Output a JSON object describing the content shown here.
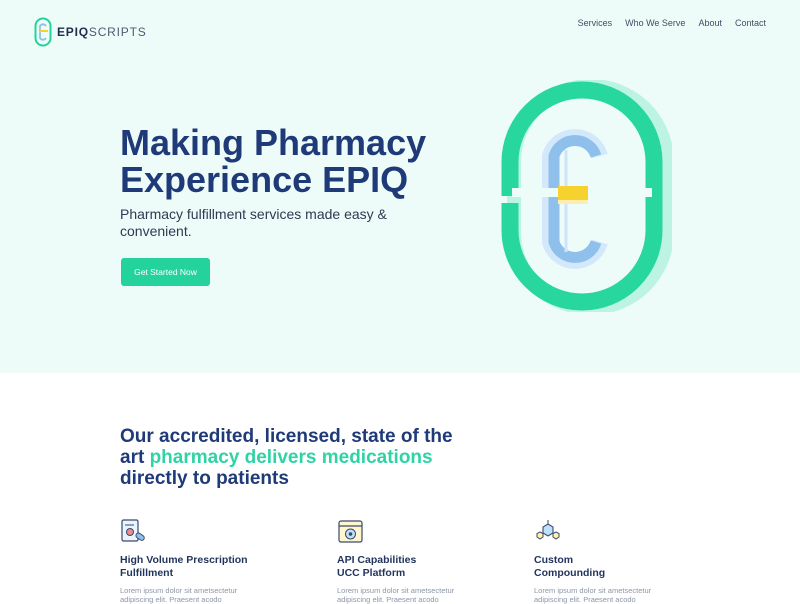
{
  "brand": {
    "name_bold": "EPIQ",
    "name_light": "SCRIPTS"
  },
  "nav": {
    "items": [
      "Services",
      "Who We Serve",
      "About",
      "Contact"
    ]
  },
  "hero": {
    "headline_line1": "Making Pharmacy",
    "headline_line2": "Experience EPIQ",
    "subtext_line1": "Pharmacy fulfillment services made easy &",
    "subtext_line2": "convenient.",
    "cta_label": "Get Started Now"
  },
  "section": {
    "intro_line1": "Our accredited, licensed, state of the",
    "intro_line2_a": "art ",
    "intro_line2_accent": "pharmacy delivers medications",
    "intro_line3": "directly to patients",
    "features": [
      {
        "icon": "prescription-document-icon",
        "title_line1": "High Volume Prescription",
        "title_line2": "Fulfillment",
        "body_line1": "Lorem ipsum dolor sit ametsectetur",
        "body_line2": "adipiscing elit. Praesent acodo"
      },
      {
        "icon": "api-window-icon",
        "title_line1": "API Capabilities",
        "title_line2": "UCC Platform",
        "body_line1": "Lorem ipsum dolor sit ametsectetur",
        "body_line2": "adipiscing elit. Praesent acodo"
      },
      {
        "icon": "molecule-icon",
        "title_line1": "Custom",
        "title_line2": "Compounding",
        "body_line1": "Lorem ipsum dolor sit ametsectetur",
        "body_line2": "adipiscing elit. Praesent acodo"
      }
    ]
  },
  "colors": {
    "hero_bg": "#eefcf9",
    "accent": "#23d39b",
    "navy": "#1f3a78",
    "light_blue": "#90bde9",
    "yellow": "#f5d22e"
  }
}
